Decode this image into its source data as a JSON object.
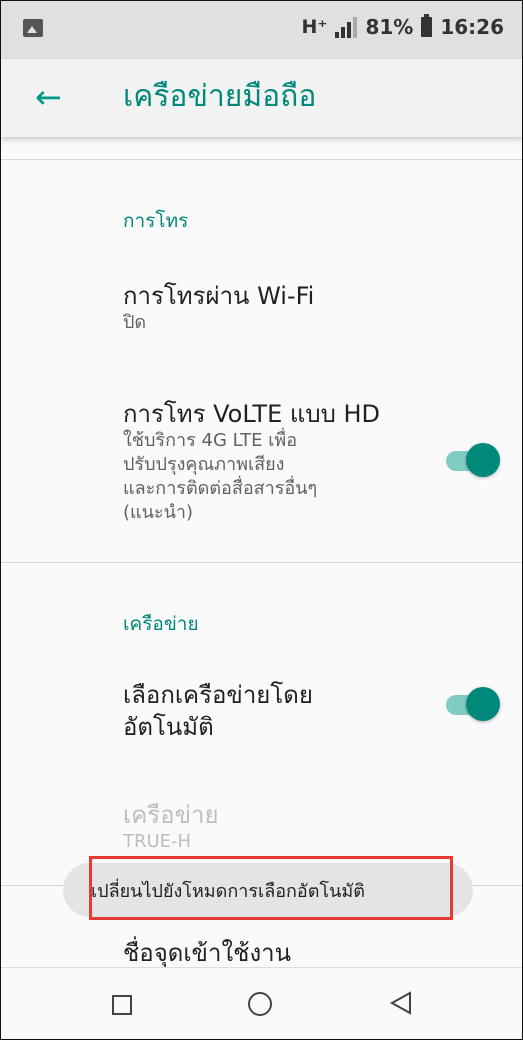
{
  "status_bar": {
    "network": "H⁺",
    "battery_percent": "81%",
    "time": "16:26"
  },
  "app_bar": {
    "title": "เครือข่ายมือถือ"
  },
  "sections": {
    "calls": {
      "title": "การโทร",
      "wifi_calling": {
        "title": "การโทรผ่าน Wi-Fi",
        "summary": "ปิด"
      },
      "volte": {
        "title": "การโทร VoLTE แบบ HD",
        "summary_lines": [
          "ใช้บริการ 4G LTE เพื่อ",
          "ปรับปรุงคุณภาพเสียง",
          "และการติดต่อสื่อสารอื่นๆ",
          "(แนะนำ)"
        ],
        "enabled": true
      }
    },
    "network": {
      "title": "เครือข่าย",
      "auto_select": {
        "title_lines": [
          "เลือกเครือข่ายโดย",
          "อัตโนมัติ"
        ],
        "enabled": true
      },
      "network_item": {
        "title": "เครือข่าย",
        "summary": "TRUE-H"
      },
      "apn": {
        "title": "ชื่อจุดเข้าใช้งาน"
      }
    }
  },
  "toast": {
    "text": "เปลี่ยนไปยังโหมดการเลือกอัตโนมัติ"
  },
  "colors": {
    "accent": "#00897b",
    "highlight_box": "#e53935"
  },
  "nav_bar": {
    "icons": [
      "recents-icon",
      "home-icon",
      "back-icon"
    ]
  }
}
